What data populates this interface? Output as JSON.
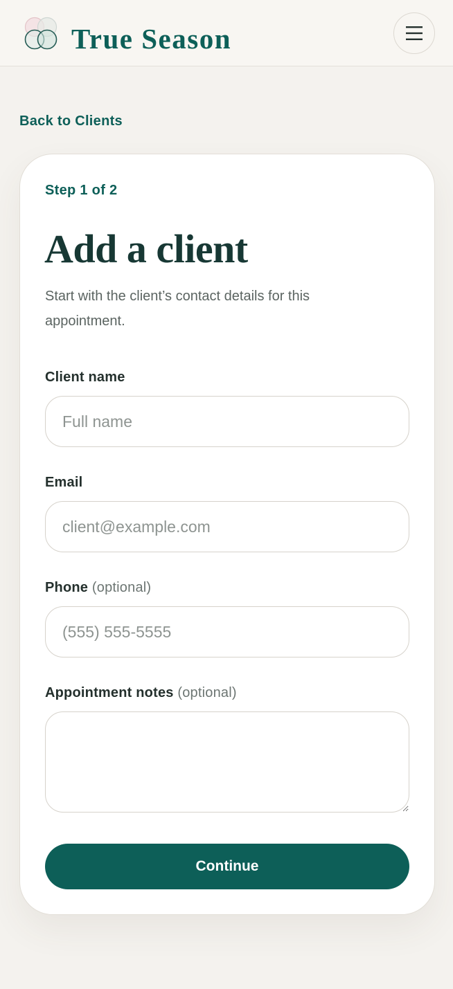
{
  "header": {
    "brand": "True Season",
    "logo_icon": "overlapping-circles-logo",
    "menu_icon": "hamburger-menu-icon"
  },
  "nav": {
    "back_label": "Back to Clients"
  },
  "form": {
    "step": "Step 1 of 2",
    "title": "Add a client",
    "subtitle": "Start with the client’s contact details for this appointment.",
    "name_label": "Client name",
    "name_placeholder": "Full name",
    "name_value": "",
    "email_label": "Email",
    "email_placeholder": "client@example.com",
    "email_value": "",
    "phone_label": "Phone",
    "phone_optional": "(optional)",
    "phone_placeholder": "(555) 555-5555",
    "phone_value": "",
    "notes_label": "Appointment notes",
    "notes_optional": "(optional)",
    "notes_value": "",
    "continue_label": "Continue"
  },
  "colors": {
    "brand": "#0d5f58",
    "background": "#f4f2ee",
    "card": "#ffffff",
    "title": "#173834"
  }
}
